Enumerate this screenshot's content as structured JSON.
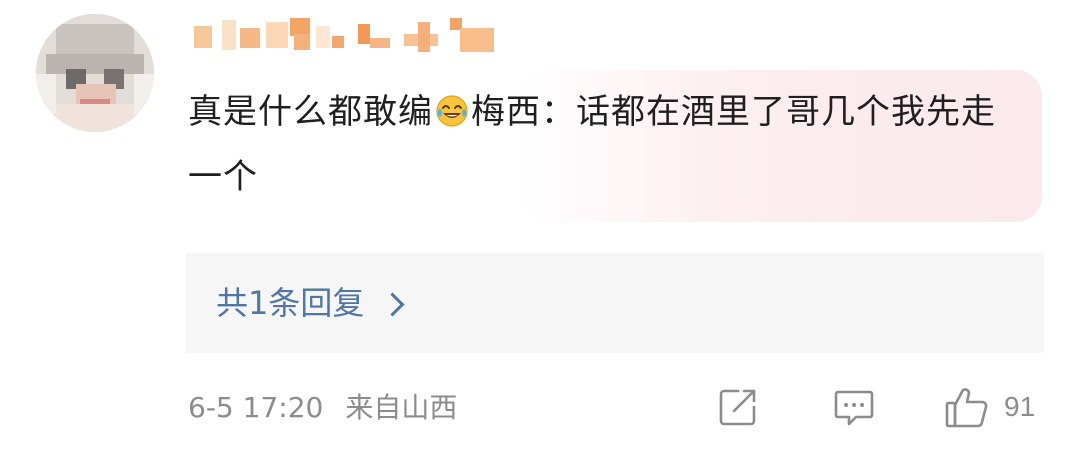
{
  "comment": {
    "content_part1": "真是什么都敢编",
    "emoji": "laughing-crying-emoji",
    "content_part2": "梅西：话都在酒里了哥几个我先走一个",
    "reply_link": "共1条回复",
    "timestamp": "6-5 17:20",
    "location": "来自山西",
    "like_count": "91"
  },
  "colors": {
    "link": "#4f76a8",
    "meta_text": "#8c8c8c",
    "body_text": "#1f1f1f",
    "reply_bg": "#f6f6f6",
    "bubble_tint": "#fbe9ed"
  },
  "icons": {
    "share": "share-icon",
    "comment": "comment-icon",
    "like": "thumbs-up-icon"
  }
}
